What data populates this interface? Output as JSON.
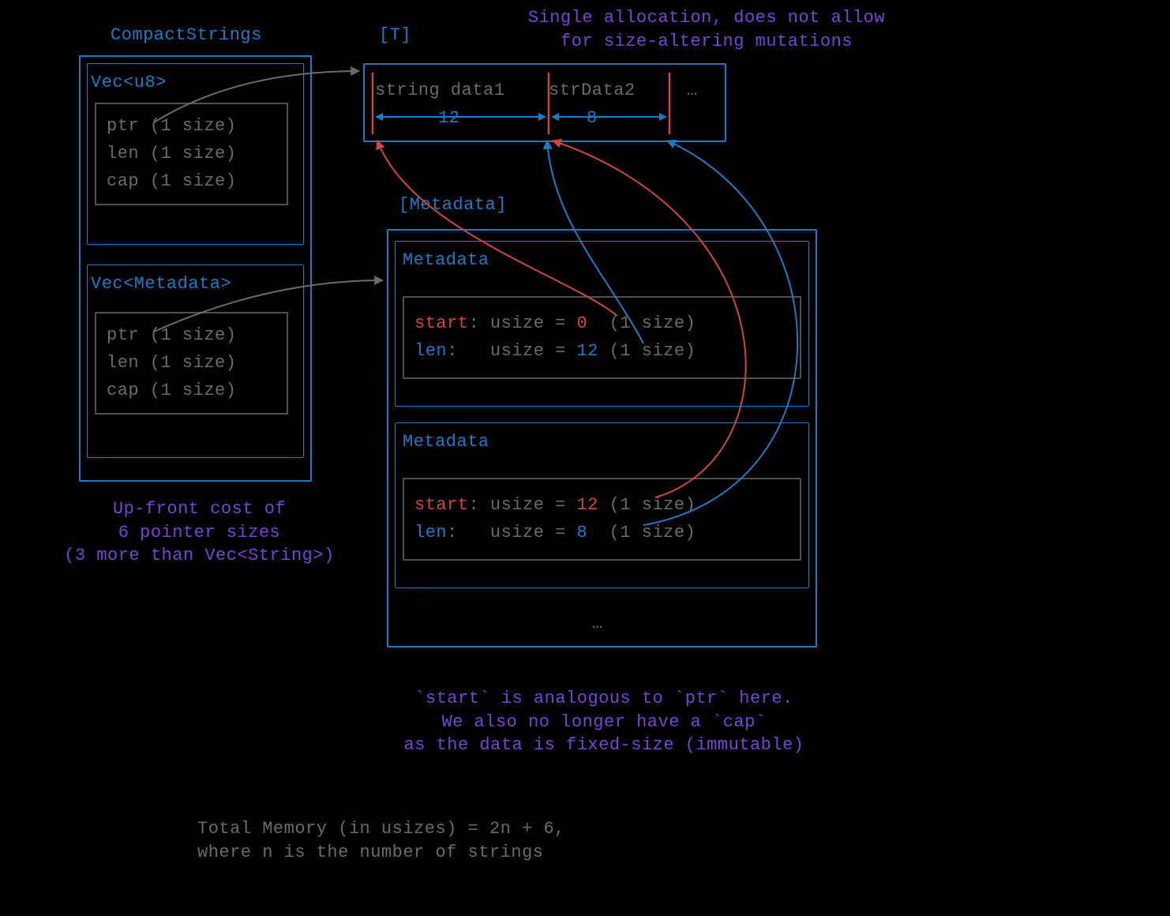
{
  "title": "CompactStrings",
  "vec_u8": {
    "label": "Vec<u8>",
    "fields": [
      "ptr (1 size)",
      "len (1 size)",
      "cap (1 size)"
    ]
  },
  "vec_meta": {
    "label": "Vec<Metadata>",
    "fields": [
      "ptr (1 size)",
      "len (1 size)",
      "cap (1 size)"
    ]
  },
  "upfront_cost": "Up-front cost of\n6 pointer sizes\n(3 more than Vec<String>)",
  "t_slice": {
    "label": "[T]",
    "data1": "string data1",
    "data2": "strData2",
    "ellipsis": "…",
    "len1": "12",
    "len2": "8"
  },
  "single_alloc": "Single allocation, does not allow\nfor size-altering mutations",
  "metadata_slice": {
    "label": "[Metadata]",
    "entry1": {
      "title": "Metadata",
      "start_label": "start",
      "start_rest": ": usize = ",
      "start_val": "0",
      "start_size": "  (1 size)",
      "len_label": "len",
      "len_rest": ":   usize = ",
      "len_val": "12",
      "len_size": " (1 size)"
    },
    "entry2": {
      "title": "Metadata",
      "start_label": "start",
      "start_rest": ": usize = ",
      "start_val": "12",
      "start_size": " (1 size)",
      "len_label": "len",
      "len_rest": ":   usize = ",
      "len_val": "8",
      "len_size": "  (1 size)"
    },
    "ellipsis": "…"
  },
  "start_analogy": "`start` is analogous to `ptr` here.\nWe also no longer have a `cap`\nas the data is fixed-size (immutable)",
  "total_memory": "Total Memory (in usizes) = 2n + 6,\nwhere n is the number of strings"
}
